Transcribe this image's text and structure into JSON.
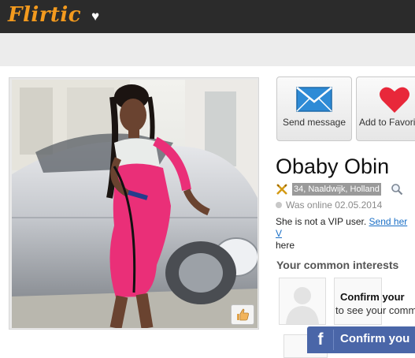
{
  "header": {
    "logo_text": "Flirtic",
    "logo_icon": "heart-icon",
    "brand_color": "#f39a1e"
  },
  "profile": {
    "photo_alt": "Profile photo",
    "name": "Obaby Obin",
    "age_location": "34, Naaldwijk, Holland",
    "online_status": "Was online 02.05.2014",
    "vip_text": "She is not a VIP user.",
    "vip_link": "Send her V",
    "vip_link_tail": "here"
  },
  "actions": {
    "send_message": "Send message",
    "add_favorite": "Add to Favorit"
  },
  "interests": {
    "title": "Your common interests",
    "confirm_title": "Confirm your",
    "confirm_sub": "to see your comm"
  },
  "facebook": {
    "icon": "f",
    "label": "Confirm you"
  }
}
